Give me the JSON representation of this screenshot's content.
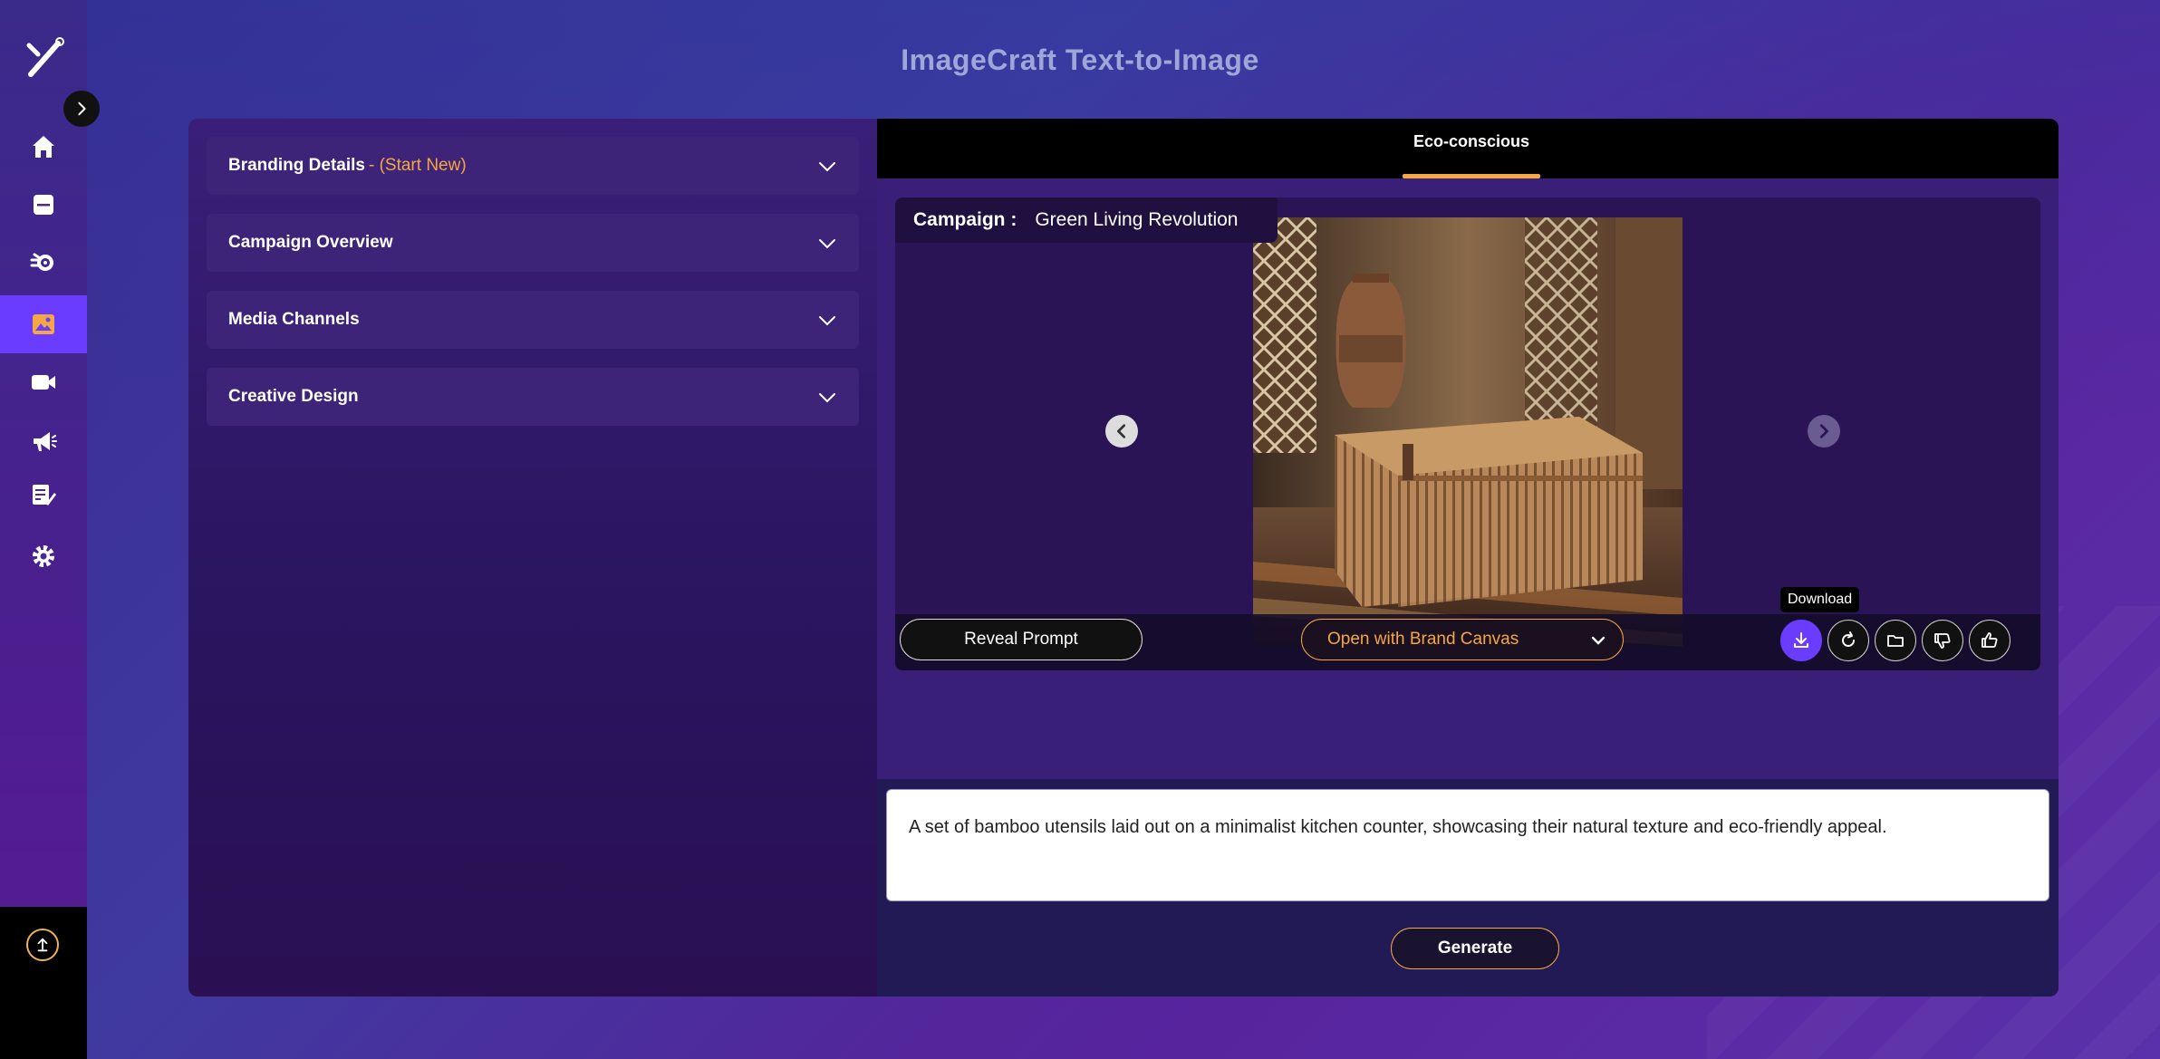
{
  "app": {
    "title": "ImageCraft Text-to-Image"
  },
  "colors": {
    "accent": "#6a3cff",
    "highlight": "#f5a742",
    "title": "#9fa6d8"
  },
  "sidebar": {
    "logo_icon": "magic-wand-icon",
    "items": [
      {
        "icon": "home-icon"
      },
      {
        "icon": "document-icon"
      },
      {
        "icon": "brain-gear-icon"
      },
      {
        "icon": "image-icon",
        "active": true
      },
      {
        "icon": "video-camera-icon"
      },
      {
        "icon": "megaphone-icon"
      },
      {
        "icon": "content-edit-icon"
      },
      {
        "icon": "gear-icon"
      }
    ],
    "collapse_icon": "chevron-right-icon",
    "upload_icon": "upload-arrow-icon"
  },
  "accordions": [
    {
      "label": "Branding Details",
      "sub": "- (Start New)"
    },
    {
      "label": "Campaign Overview",
      "sub": ""
    },
    {
      "label": "Media Channels",
      "sub": ""
    },
    {
      "label": "Creative Design",
      "sub": ""
    }
  ],
  "tabs": [
    {
      "label": "Eco-conscious",
      "active": true
    }
  ],
  "viewer": {
    "campaign_key": "Campaign :",
    "campaign_value": "Green Living Revolution",
    "reveal_prompt": "Reveal Prompt",
    "brand_canvas": "Open with Brand Canvas",
    "tooltip": "Download",
    "actions": [
      "download-icon",
      "regenerate-icon",
      "folder-icon",
      "thumbs-down-icon",
      "thumbs-up-icon"
    ]
  },
  "prompt": {
    "text": "A set of bamboo utensils laid out on a minimalist kitchen counter, showcasing their natural texture and eco-friendly appeal."
  },
  "generate_label": "Generate"
}
